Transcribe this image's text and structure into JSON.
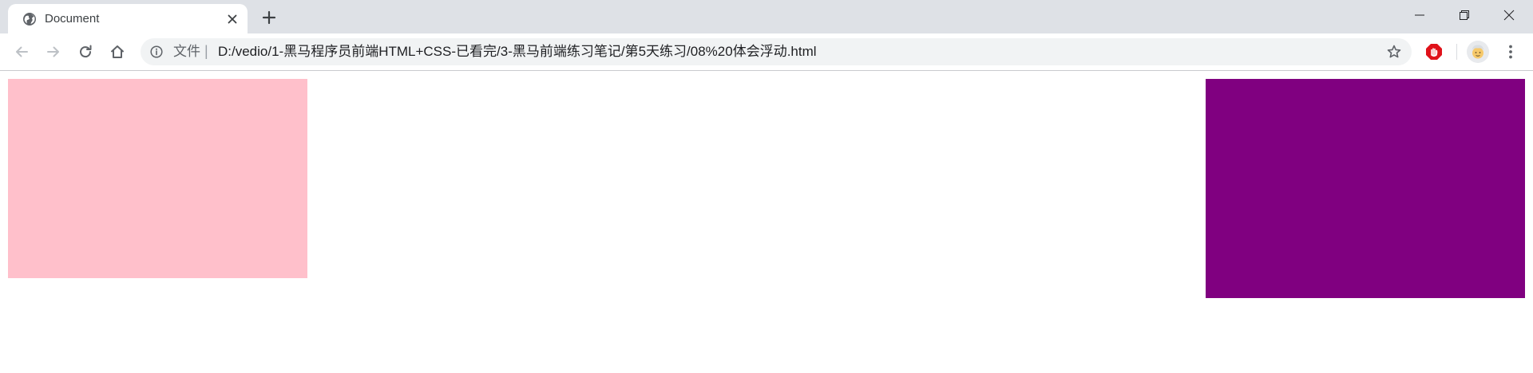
{
  "browser": {
    "tab": {
      "title": "Document",
      "favicon": "globe-icon"
    },
    "new_tab_icon": "plus-icon",
    "window_controls": [
      "minimize-icon",
      "restore-icon",
      "close-icon"
    ],
    "toolbar": {
      "back_icon": "arrow-left-icon",
      "forward_icon": "arrow-right-icon",
      "reload_icon": "reload-icon",
      "home_icon": "home-icon",
      "site_info_label": "文件",
      "site_info_separator": "|",
      "url": "D:/vedio/1-黑马程序员前端HTML+CSS-已看完/3-黑马前端练习笔记/第5天练习/08%20体会浮动.html",
      "bookmark_icon": "star-icon",
      "extension_icon": "adblock-icon",
      "profile_icon": "avatar",
      "menu_icon": "kebab-menu-icon"
    }
  },
  "page": {
    "boxes": [
      {
        "name": "pink-box",
        "color": "#ffc0cb"
      },
      {
        "name": "purple-box",
        "color": "#800080"
      }
    ]
  }
}
